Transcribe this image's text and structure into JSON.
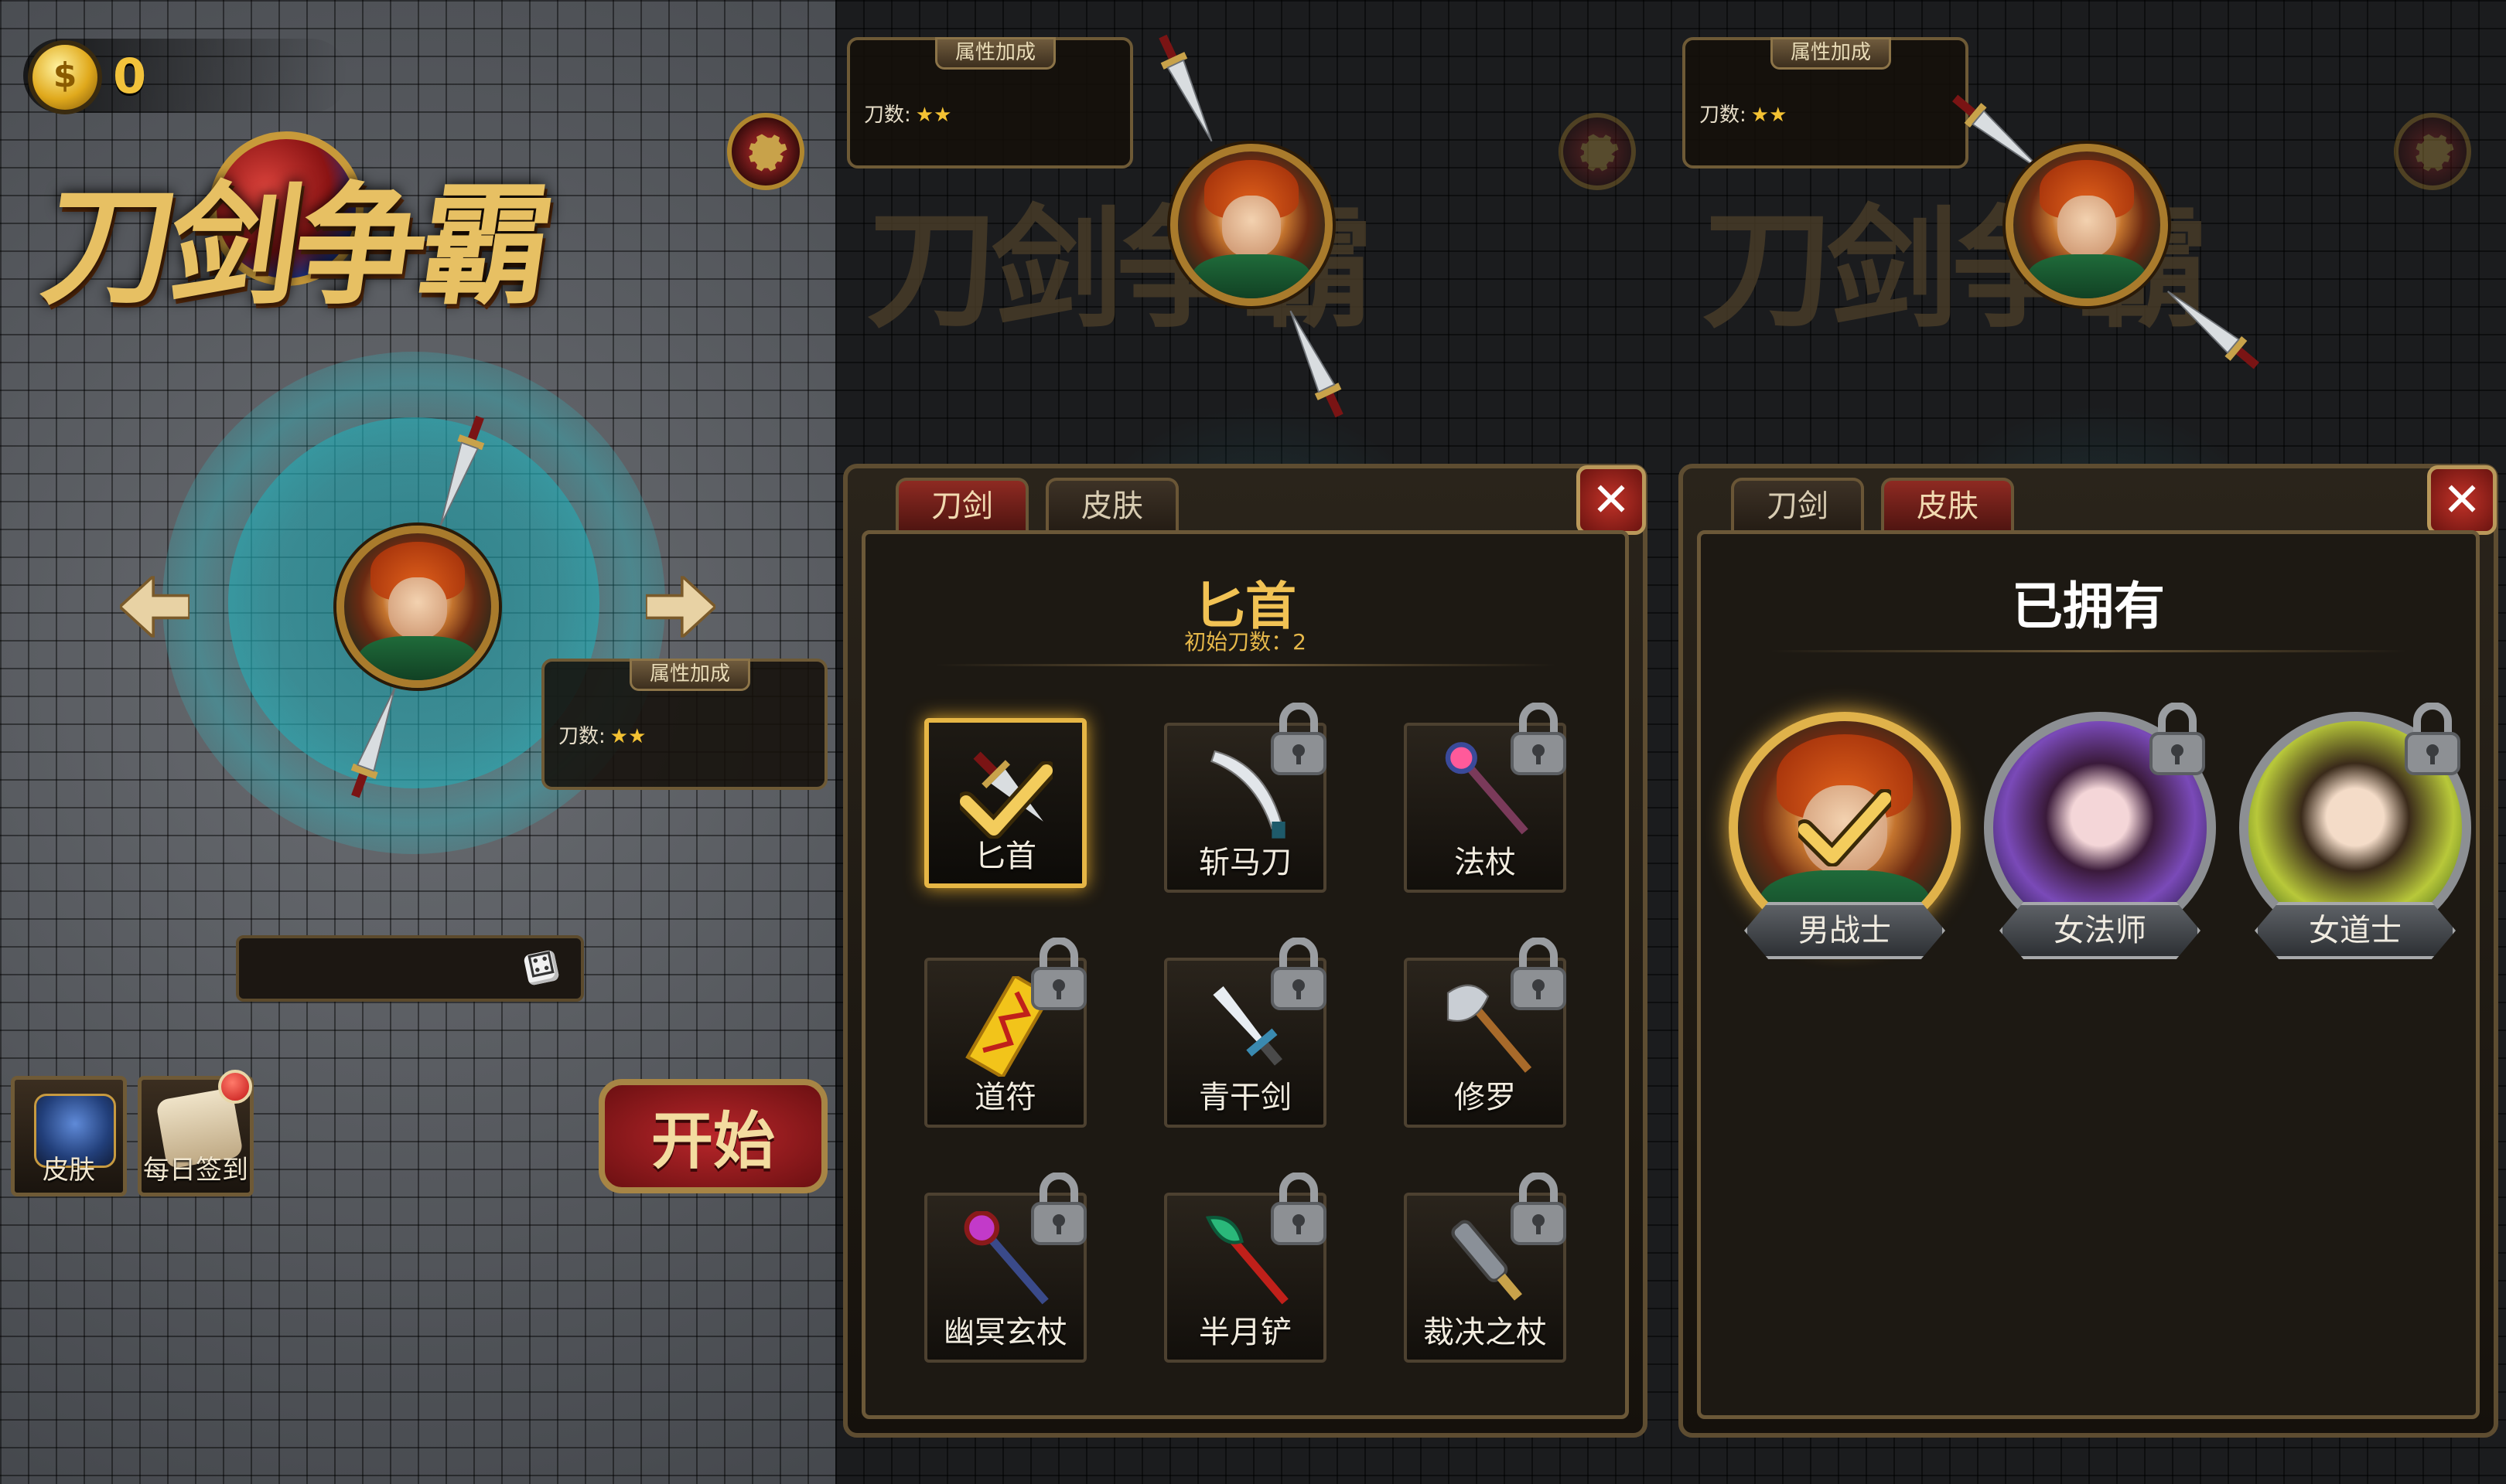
{
  "main": {
    "coins": "0",
    "logo_text": "刀剑争霸",
    "attr_panel": {
      "title": "属性加成",
      "label": "刀数:",
      "stars": "★★"
    },
    "skin_button_label": "皮肤",
    "daily_button_label": "每日签到",
    "start_label": "开始"
  },
  "weapons_dialog": {
    "tabs": [
      {
        "label": "刀剑",
        "active": true
      },
      {
        "label": "皮肤",
        "active": false
      }
    ],
    "close_label": "✕",
    "selected_title": "匕首",
    "selected_subtitle": "初始刀数：2",
    "items": [
      {
        "label": "匕首",
        "locked": false,
        "selected": true,
        "icon": "dagger-icon"
      },
      {
        "label": "斩马刀",
        "locked": true,
        "selected": false,
        "icon": "saber-icon"
      },
      {
        "label": "法杖",
        "locked": true,
        "selected": false,
        "icon": "staff-icon"
      },
      {
        "label": "道符",
        "locked": true,
        "selected": false,
        "icon": "talisman-icon"
      },
      {
        "label": "青干剑",
        "locked": true,
        "selected": false,
        "icon": "sword-icon"
      },
      {
        "label": "修罗",
        "locked": true,
        "selected": false,
        "icon": "axe-icon"
      },
      {
        "label": "幽冥玄杖",
        "locked": true,
        "selected": false,
        "icon": "scepter-icon"
      },
      {
        "label": "半月铲",
        "locked": true,
        "selected": false,
        "icon": "crescent-spade-icon"
      },
      {
        "label": "裁决之杖",
        "locked": true,
        "selected": false,
        "icon": "mace-icon"
      }
    ]
  },
  "skins_dialog": {
    "tabs": [
      {
        "label": "刀剑",
        "active": false
      },
      {
        "label": "皮肤",
        "active": true
      }
    ],
    "close_label": "✕",
    "title": "已拥有",
    "skins": [
      {
        "label": "男战士",
        "locked": false,
        "selected": true
      },
      {
        "label": "女法师",
        "locked": true,
        "selected": false
      },
      {
        "label": "女道士",
        "locked": true,
        "selected": false
      }
    ]
  },
  "colors": {
    "gold": "#e6b645",
    "accent_red": "#8e2a22",
    "teal_ring": "#2ab8c4"
  }
}
